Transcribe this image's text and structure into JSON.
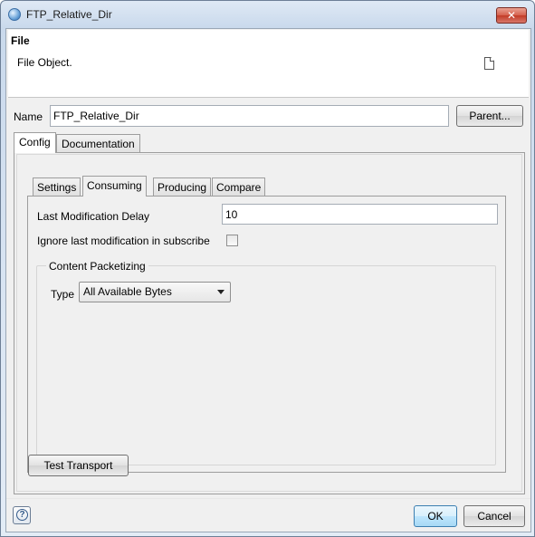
{
  "window": {
    "title": "FTP_Relative_Dir",
    "close_label": "✕"
  },
  "header": {
    "title": "File",
    "description": "File Object."
  },
  "name_field": {
    "label": "Name",
    "value": "FTP_Relative_Dir"
  },
  "parent_button": "Parent...",
  "outer_tabs": [
    {
      "label": "Config",
      "active": true
    },
    {
      "label": "Documentation",
      "active": false
    }
  ],
  "inner_tabs": [
    {
      "label": "Settings",
      "active": false
    },
    {
      "label": "Consuming",
      "active": true
    },
    {
      "label": "Producing",
      "active": false
    },
    {
      "label": "Compare",
      "active": false
    }
  ],
  "consuming": {
    "delay_label": "Last Modification Delay",
    "delay_value": "10",
    "ignore_label": "Ignore last modification in subscribe",
    "ignore_checked": false,
    "group_title": "Content Packetizing",
    "type_label": "Type",
    "type_value": "All Available Bytes"
  },
  "test_button": "Test Transport",
  "footer": {
    "help_glyph": "?",
    "ok_label": "OK",
    "cancel_label": "Cancel"
  },
  "colors": {
    "ok_button_accent": "#a7d9f5",
    "close_button": "#c23b26"
  }
}
